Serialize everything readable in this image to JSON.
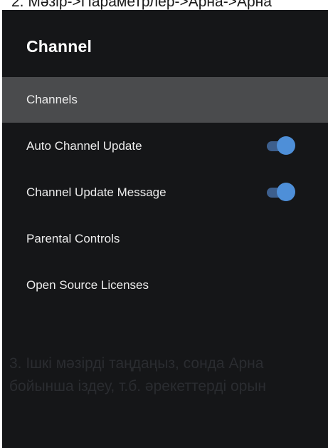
{
  "caption_top": "2. Мәзір->Параметрлер->Арна->Арна",
  "panel": {
    "title": "Channel",
    "items": [
      {
        "label": "Channels",
        "selected": true,
        "toggle": null
      },
      {
        "label": "Auto Channel Update",
        "selected": false,
        "toggle": "on"
      },
      {
        "label": "Channel Update Message",
        "selected": false,
        "toggle": "on"
      },
      {
        "label": "Parental Controls",
        "selected": false,
        "toggle": null
      },
      {
        "label": "Open Source Licenses",
        "selected": false,
        "toggle": null
      }
    ]
  },
  "background_text": {
    "line1": "3. Ішкі мәзірді таңдаңыз, сонда Арна",
    "line2": "бойынша іздеу, т.б. әрекеттерді орын"
  },
  "colors": {
    "panel_bg": "#151618",
    "selected_bg": "#4a4b4d",
    "toggle_knob": "#4e8fd8",
    "toggle_track": "#3d5f8d"
  }
}
